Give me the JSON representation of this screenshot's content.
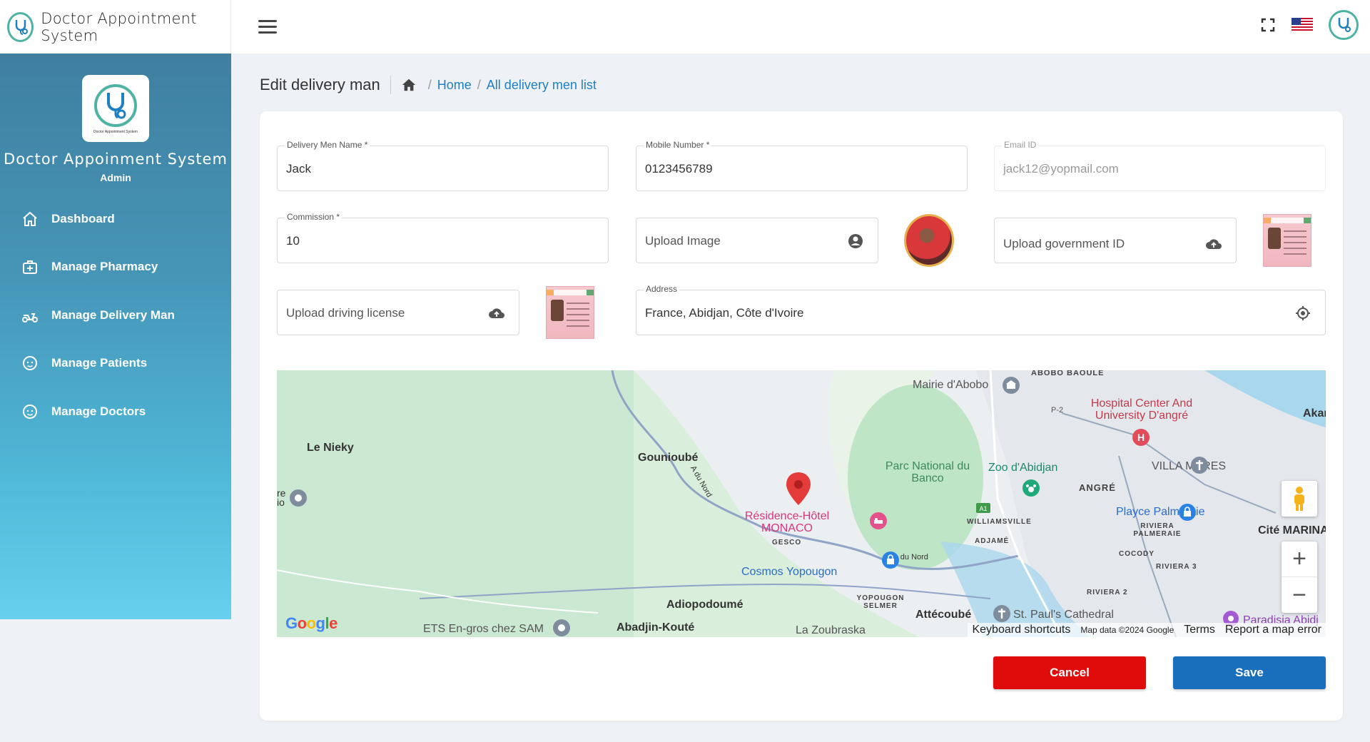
{
  "app": {
    "title": "Doctor Appointment System",
    "sidebar_title": "Doctor Appoinment System",
    "role": "Admin",
    "logo_caption": "Doctor Appointment System"
  },
  "sidebar": {
    "items": [
      {
        "label": "Dashboard",
        "icon": "home-icon"
      },
      {
        "label": "Manage Pharmacy",
        "icon": "medical-kit-icon"
      },
      {
        "label": "Manage Delivery Man",
        "icon": "scooter-icon"
      },
      {
        "label": "Manage Patients",
        "icon": "face-icon"
      },
      {
        "label": "Manage Doctors",
        "icon": "face-icon"
      }
    ]
  },
  "header": {
    "page_title": "Edit delivery man",
    "breadcrumb": [
      "Home",
      "All delivery men list"
    ],
    "breadcrumb_sep": "/"
  },
  "form": {
    "name": {
      "label": "Delivery Men Name *",
      "value": "Jack"
    },
    "mobile": {
      "label": "Mobile Number *",
      "value": "0123456789"
    },
    "email": {
      "label": "Email ID",
      "value": "jack12@yopmail.com"
    },
    "commission": {
      "label": "Commission *",
      "value": "10"
    },
    "upload_image": {
      "label": "Upload Image"
    },
    "upload_gov_id": {
      "label": "Upload government ID"
    },
    "upload_license": {
      "label": "Upload driving license"
    },
    "address": {
      "label": "Address",
      "value": "France, Abidjan, Côte d'Ivoire"
    }
  },
  "map": {
    "labels": {
      "le_nieky": "Le Nieky",
      "gouniouble": "Gounioubé",
      "mairie": "Mairie d'Abobo",
      "abobo_baoule": "ABOBO BAOULE",
      "hospital": "Hospital Center And University D'angré",
      "akan": "Akan",
      "parc": "Parc National du Banco",
      "zoo": "Zoo d'Abidjan",
      "villa": "VILLA MARES",
      "angre": "ANGRÉ",
      "playce": "Playce Palmeraie",
      "riviera_palmeraie": "RIVIERA PALMERAIE",
      "cite_marina": "Cité MARINA",
      "residence": "Résidence-Hôtel MONACO",
      "gesco": "GESCO",
      "williamsville": "WILLIAMSVILLE",
      "adjame": "ADJAMÉ",
      "cocody": "COCODY",
      "riviera3": "RIVIERA 3",
      "riviera2": "RIVIERA 2",
      "cosmos": "Cosmos Yopougon",
      "adiopodoume": "Adiopodoumé",
      "yopougon_selmer": "YOPOUGON SELMER",
      "attecoube": "Attécoubé",
      "st_paul": "St. Paul's Cathedral",
      "paradisia": "Paradisia Abidj",
      "ets": "ETS En-gros chez SAM",
      "abadjin": "Abadjin-Kouté",
      "zoubraska": "La Zoubraska",
      "road_nord": "A du Nord",
      "road_nord2": "A du Nord",
      "p2": "P-2",
      "a1": "A1",
      "re_io": "re io"
    },
    "google": "Google",
    "footer": {
      "shortcuts": "Keyboard shortcuts",
      "mapdata": "Map data ©2024 Google",
      "terms": "Terms",
      "report": "Report a map error"
    },
    "zoom_in": "+",
    "zoom_out": "−"
  },
  "buttons": {
    "cancel": "Cancel",
    "save": "Save"
  },
  "colors": {
    "sidebar_top": "#3f7fa0",
    "sidebar_bottom": "#66d0ee",
    "link": "#1e7fc2",
    "cancel": "#e00b0b",
    "save": "#1a6fbd"
  }
}
